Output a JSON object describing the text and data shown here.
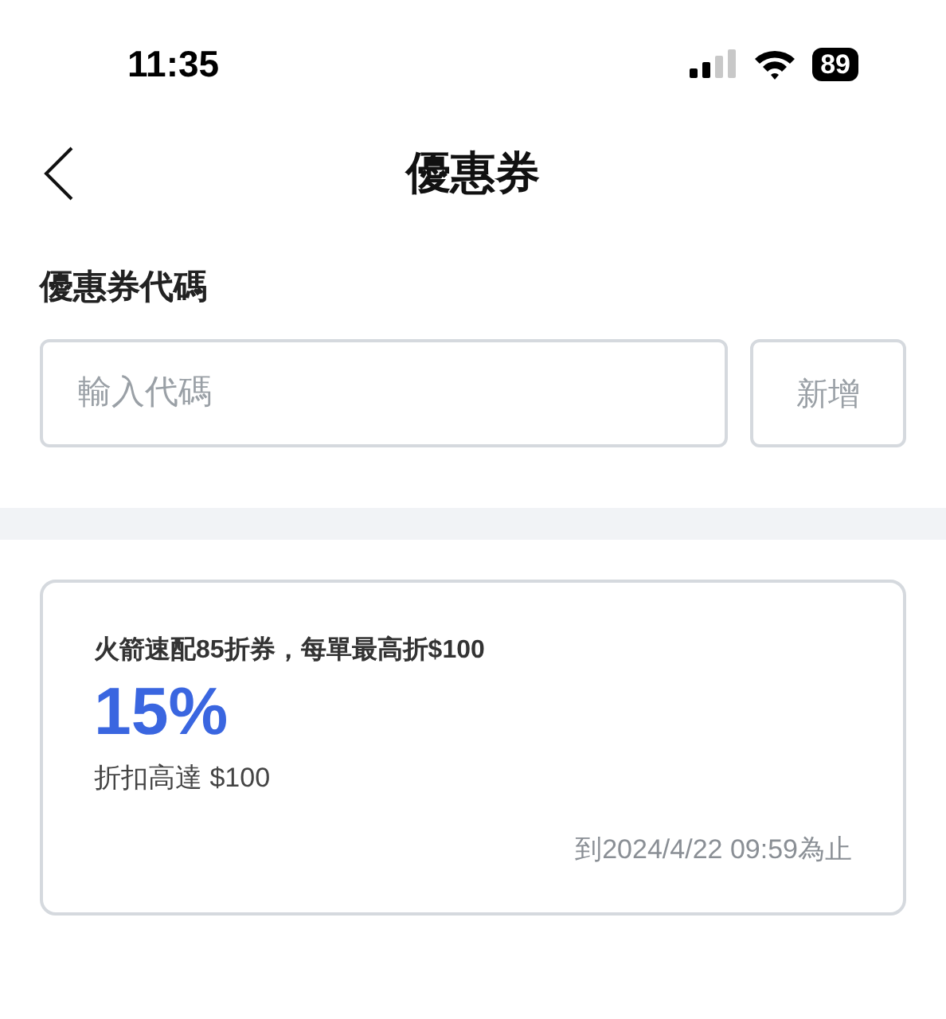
{
  "status_bar": {
    "time": "11:35",
    "battery": "89"
  },
  "nav": {
    "title": "優惠券"
  },
  "code_section": {
    "label": "優惠券代碼",
    "placeholder": "輸入代碼",
    "button": "新增",
    "button_disabled": true
  },
  "coupons": [
    {
      "title": "火箭速配85折券，每單最高折$100",
      "discount": "15%",
      "limit": "折扣高達 $100",
      "expiry": "到2024/4/22 09:59為止"
    }
  ]
}
